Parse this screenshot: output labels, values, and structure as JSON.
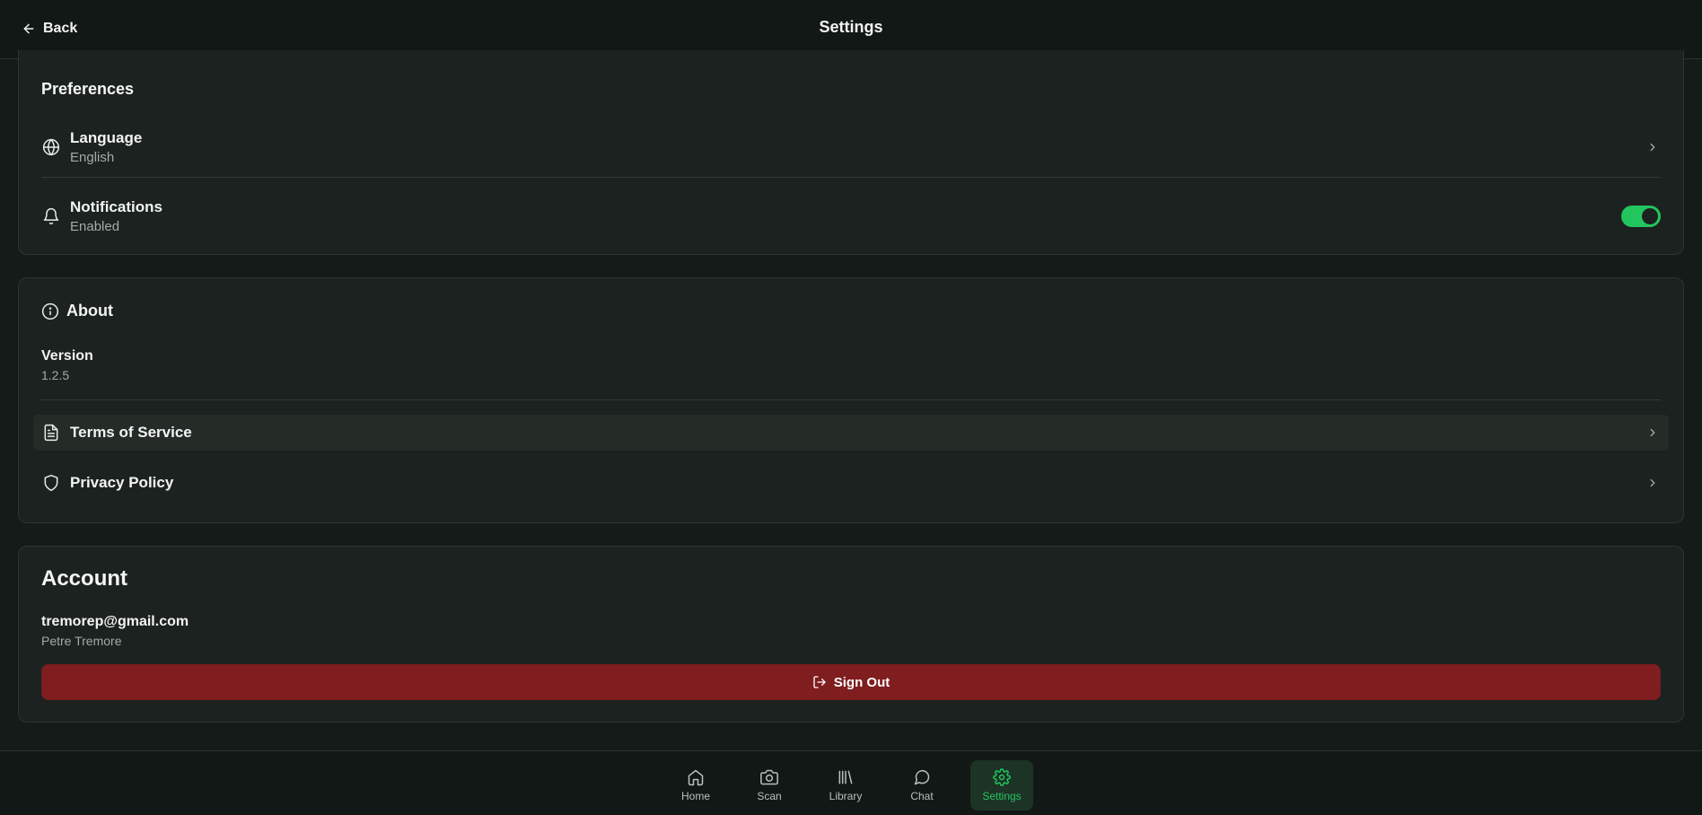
{
  "header": {
    "back_label": "Back",
    "title": "Settings"
  },
  "preferences": {
    "title": "Preferences",
    "language": {
      "label": "Language",
      "value": "English",
      "icon": "globe-icon"
    },
    "notifications": {
      "label": "Notifications",
      "value": "Enabled",
      "icon": "bell-icon",
      "toggle_on": true
    }
  },
  "about": {
    "title": "About",
    "version": {
      "label": "Version",
      "value": "1.2.5"
    },
    "terms": {
      "label": "Terms of Service",
      "icon": "document-icon"
    },
    "privacy": {
      "label": "Privacy Policy",
      "icon": "shield-icon"
    }
  },
  "account": {
    "title": "Account",
    "email": "tremorep@gmail.com",
    "name": "Petre Tremore",
    "sign_out_label": "Sign Out"
  },
  "bottom_nav": {
    "items": [
      {
        "label": "Home",
        "icon": "home-icon"
      },
      {
        "label": "Scan",
        "icon": "camera-icon"
      },
      {
        "label": "Library",
        "icon": "library-icon"
      },
      {
        "label": "Chat",
        "icon": "chat-icon"
      },
      {
        "label": "Settings",
        "icon": "gear-icon",
        "active": true
      }
    ]
  },
  "colors": {
    "background": "#151b18",
    "card": "#1c221f",
    "accent": "#22c55e",
    "danger": "#7f1d1f"
  }
}
